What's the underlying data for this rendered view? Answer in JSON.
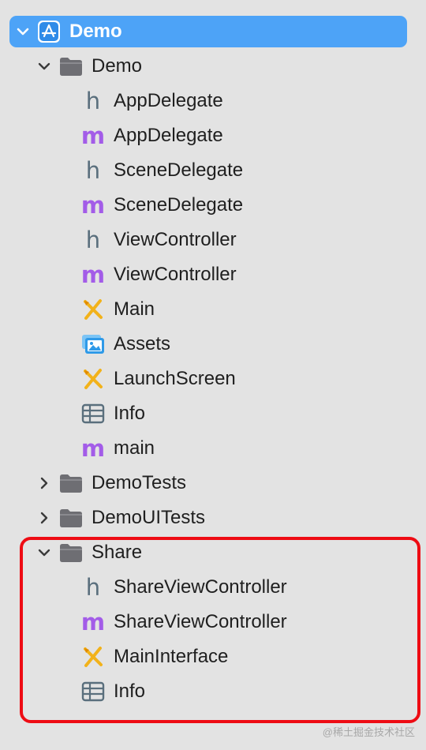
{
  "project": {
    "label": "Demo",
    "icon": "xcode-project-icon"
  },
  "tree": [
    {
      "label": "Demo",
      "type": "folder",
      "expanded": true
    },
    {
      "label": "AppDelegate",
      "type": "header"
    },
    {
      "label": "AppDelegate",
      "type": "implementation"
    },
    {
      "label": "SceneDelegate",
      "type": "header"
    },
    {
      "label": "SceneDelegate",
      "type": "implementation"
    },
    {
      "label": "ViewController",
      "type": "header"
    },
    {
      "label": "ViewController",
      "type": "implementation"
    },
    {
      "label": "Main",
      "type": "storyboard"
    },
    {
      "label": "Assets",
      "type": "asset-catalog"
    },
    {
      "label": "LaunchScreen",
      "type": "storyboard"
    },
    {
      "label": "Info",
      "type": "plist"
    },
    {
      "label": "main",
      "type": "implementation"
    },
    {
      "label": "DemoTests",
      "type": "folder",
      "expanded": false
    },
    {
      "label": "DemoUITests",
      "type": "folder",
      "expanded": false
    },
    {
      "label": "Share",
      "type": "folder",
      "expanded": true
    },
    {
      "label": "ShareViewController",
      "type": "header"
    },
    {
      "label": "ShareViewController",
      "type": "implementation"
    },
    {
      "label": "MainInterface",
      "type": "storyboard"
    },
    {
      "label": "Info",
      "type": "plist"
    }
  ],
  "watermark": "@稀土掘金技术社区",
  "colors": {
    "selection": "#4da3f7",
    "highlight": "#ee0c14",
    "header_glyph": "#5a6f7d",
    "impl_glyph": "#a35ce8",
    "folder": "#6e6e73",
    "storyboard": "#f2b21a",
    "assets": "#2f9ae8"
  }
}
